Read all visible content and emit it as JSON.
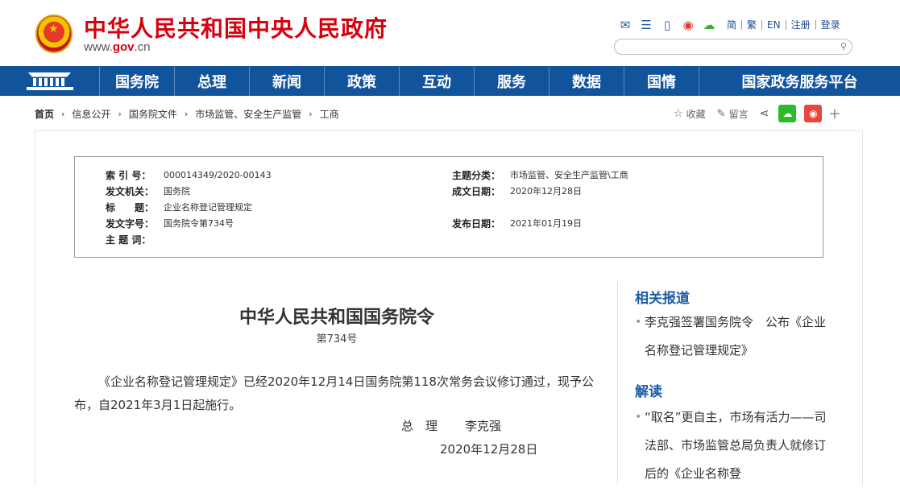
{
  "header": {
    "site_title": "中华人民共和国中央人民政府",
    "url_prefix": "www.",
    "url_domain": "gov",
    "url_suffix": ".cn",
    "top_links": [
      "简",
      "繁",
      "EN",
      "注册",
      "登录"
    ],
    "search_placeholder": ""
  },
  "nav": {
    "items": [
      "国务院",
      "总理",
      "新闻",
      "政策",
      "互动",
      "服务",
      "数据",
      "国情",
      "国家政务服务平台"
    ]
  },
  "breadcrumb": {
    "items": [
      "首页",
      "信息公开",
      "国务院文件",
      "市场监管、安全生产监管",
      "工商"
    ]
  },
  "actions": {
    "favorite": "收藏",
    "comment": "留言"
  },
  "info": {
    "index_label": "索 引 号：",
    "index_value": "000014349/2020-00143",
    "category_label": "主题分类：",
    "category_value": "市场监管、安全生产监管\\工商",
    "issuer_label": "发文机关：",
    "issuer_value": "国务院",
    "created_label": "成文日期：",
    "created_value": "2020年12月28日",
    "title_label": "标　　题：",
    "title_value": "企业名称登记管理规定",
    "docno_label": "发文字号：",
    "docno_value": "国务院令第734号",
    "published_label": "发布日期：",
    "published_value": "2021年01月19日",
    "keywords_label": "主 题 词："
  },
  "document": {
    "title": "中华人民共和国国务院令",
    "number": "第734号",
    "body": "《企业名称登记管理规定》已经2020年12月14日国务院第118次常务会议修订通过，现予公布，自2021年3月1日起施行。",
    "signer_title": "总　理",
    "signer_name": "李克强",
    "date": "2020年12月28日"
  },
  "sidebar": {
    "related_heading": "相关报道",
    "related_item": "李克强签署国务院令　公布《企业名称登记管理规定》",
    "interpret_heading": "解读",
    "interpret_item": "“取名”更自主，市场有活力——司法部、市场监管总局负责人就修订后的《企业名称登"
  },
  "colors": {
    "brand_red": "#d7000f",
    "nav_blue": "#12549c",
    "link_blue": "#1a5ba6"
  },
  "icons": [
    "emblem-icon",
    "mail-icon",
    "message-icon",
    "mobile-icon",
    "weibo-icon",
    "wechat-icon",
    "search-icon",
    "star-icon",
    "pencil-icon",
    "share-icon",
    "plus-icon",
    "chevron-right-icon"
  ]
}
